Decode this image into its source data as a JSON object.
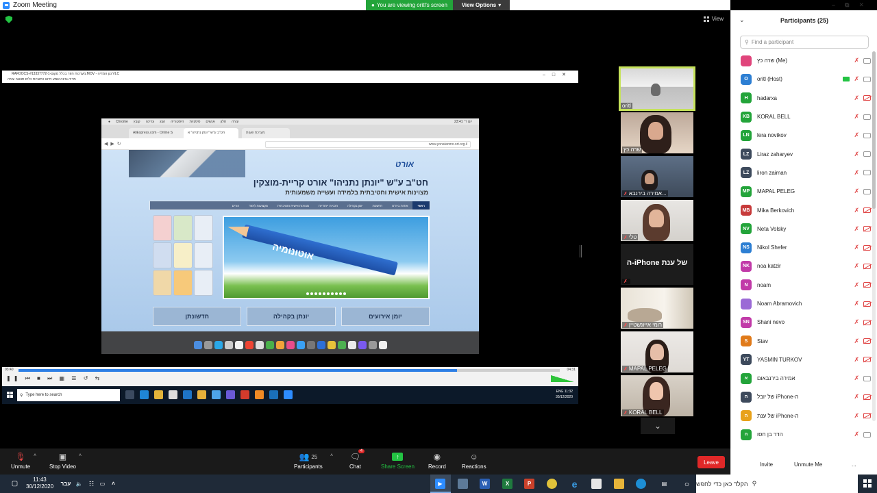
{
  "window": {
    "title": "Zoom Meeting",
    "share_banner": "You are viewing oritl's screen",
    "view_options": "View Options",
    "view_label": "View"
  },
  "shared_screen": {
    "vlc_title": "RAFDOCS-#13337772-1-מערכות חוזר בכלל מקום.MOV - נגן המדיה VLC",
    "vlc_menu": "מדיה  נגינה  שמע  וידאו  כתוביות  כלים  תצוגה  עזרה",
    "mac_menu": [
      "Chrome",
      "קובץ",
      "עריכה",
      "הצג",
      "היסטוריה",
      "סימניות",
      "אנשים",
      "חלון",
      "עזרה"
    ],
    "mac_status_right": "יום ד׳ 23:41",
    "tab1": "AliExpress.com - Online S",
    "tab2": "חט\"ב ע\"ש \"יונתן נתניהו\" א",
    "tab3": "מערכת שעות",
    "url": "www.yonatanmo.ort.org.il",
    "site_logo": "אורט",
    "site_title": "חט\"ב ע\"ש \"יונתן נתניהו\" אורט קריית-מוצקין",
    "site_subtitle": "מצוינות אישית וחטיבתית בלמידה ועשייה משמעותית",
    "site_nav": [
      "ראשי",
      "אודות ביה\"ס",
      "חדשנות",
      "יומן בקהילה",
      "תכניות ייחודיות",
      "מצוינות אישית וחטיבתית",
      "מקצועות לימוד",
      "הורים"
    ],
    "hero_text": "אוטונומיה",
    "tiles": [
      "חדשונתן",
      "יונתן בקהילה",
      "יומן אירועים"
    ],
    "time_left": "03:40",
    "time_right": "04:31",
    "progress_fraction": 0.81,
    "win_search": "Type here to search",
    "win_clock_time": "11:32",
    "win_clock_date": "30/12/2020",
    "win_lang": "ENG"
  },
  "videos": [
    {
      "name": "oritl",
      "muted": false
    },
    {
      "name": "שרה כץ",
      "muted": false
    },
    {
      "name": "אמירה בירנבא...",
      "muted": true
    },
    {
      "name": "טלי",
      "muted": true
    },
    {
      "name": "",
      "muted": true,
      "placeholder": "של ענת iPhone-ה"
    },
    {
      "name": "רומי אייזנשטיין",
      "muted": true
    },
    {
      "name": "MAPAL PELEG",
      "muted": true
    },
    {
      "name": "KORAL BELL",
      "muted": true
    }
  ],
  "toolbar": {
    "unmute": "Unmute",
    "stop_video": "Stop Video",
    "participants": "Participants",
    "participants_count": "25",
    "chat": "Chat",
    "chat_badge": "4",
    "share_screen": "Share Screen",
    "record": "Record",
    "reactions": "Reactions",
    "leave": "Leave"
  },
  "panel": {
    "title": "Participants (25)",
    "search_placeholder": "Find a participant",
    "participants": [
      {
        "initials": "",
        "name": "שרה כץ (Me)",
        "color": "#e0457b",
        "cam_off": false,
        "sharing": false
      },
      {
        "initials": "O",
        "name": "oritl (Host)",
        "color": "#2d7fd3",
        "cam_off": false,
        "sharing": true
      },
      {
        "initials": "H",
        "name": "hadarxa",
        "color": "#23a43a",
        "cam_off": true,
        "sharing": false
      },
      {
        "initials": "KB",
        "name": "KORAL BELL",
        "color": "#23a43a",
        "cam_off": false,
        "sharing": false
      },
      {
        "initials": "LN",
        "name": "lera novikov",
        "color": "#23a43a",
        "cam_off": false,
        "sharing": false
      },
      {
        "initials": "LZ",
        "name": "Liraz zaharyev",
        "color": "#3d4a5c",
        "cam_off": false,
        "sharing": false
      },
      {
        "initials": "LZ",
        "name": "liron zaiman",
        "color": "#3d4a5c",
        "cam_off": false,
        "sharing": false
      },
      {
        "initials": "MP",
        "name": "MAPAL PELEG",
        "color": "#23a43a",
        "cam_off": false,
        "sharing": false
      },
      {
        "initials": "MB",
        "name": "Mika Berkovich",
        "color": "#c73b3b",
        "cam_off": true,
        "sharing": false
      },
      {
        "initials": "NV",
        "name": "Neta Volsky",
        "color": "#23a43a",
        "cam_off": true,
        "sharing": false
      },
      {
        "initials": "NS",
        "name": "Nikol Shefer",
        "color": "#2d7fd3",
        "cam_off": true,
        "sharing": false
      },
      {
        "initials": "NK",
        "name": "noa katzir",
        "color": "#c13aa8",
        "cam_off": true,
        "sharing": false
      },
      {
        "initials": "N",
        "name": "noam",
        "color": "#c13aa8",
        "cam_off": true,
        "sharing": false
      },
      {
        "initials": "",
        "name": "Noam Abramovich",
        "color": "#9b6ad6",
        "cam_off": true,
        "sharing": false
      },
      {
        "initials": "SN",
        "name": "Shani nevo",
        "color": "#c13aa8",
        "cam_off": true,
        "sharing": false
      },
      {
        "initials": "S",
        "name": "Stav",
        "color": "#e07a1a",
        "cam_off": true,
        "sharing": false
      },
      {
        "initials": "YT",
        "name": "YASMIN TURKOV",
        "color": "#3d4a5c",
        "cam_off": true,
        "sharing": false
      },
      {
        "initials": "א",
        "name": "אמירה בירנבאום",
        "color": "#23a43a",
        "cam_off": false,
        "sharing": false
      },
      {
        "initials": "ה",
        "name": "של יובל iPhone-ה",
        "color": "#3d4a5c",
        "cam_off": true,
        "sharing": false
      },
      {
        "initials": "ה",
        "name": "של ענת iPhone-ה",
        "color": "#e8a21a",
        "cam_off": true,
        "sharing": false
      },
      {
        "initials": "ה",
        "name": "הדר בן חסו",
        "color": "#23a43a",
        "cam_off": false,
        "sharing": false
      }
    ],
    "invite": "Invite",
    "unmute_me": "Unmute Me",
    "more": "..."
  },
  "os_taskbar": {
    "time": "11:43",
    "date": "30/12/2020",
    "lang": "עבר",
    "search_placeholder": "הקלד כאן כדי לחפש"
  }
}
